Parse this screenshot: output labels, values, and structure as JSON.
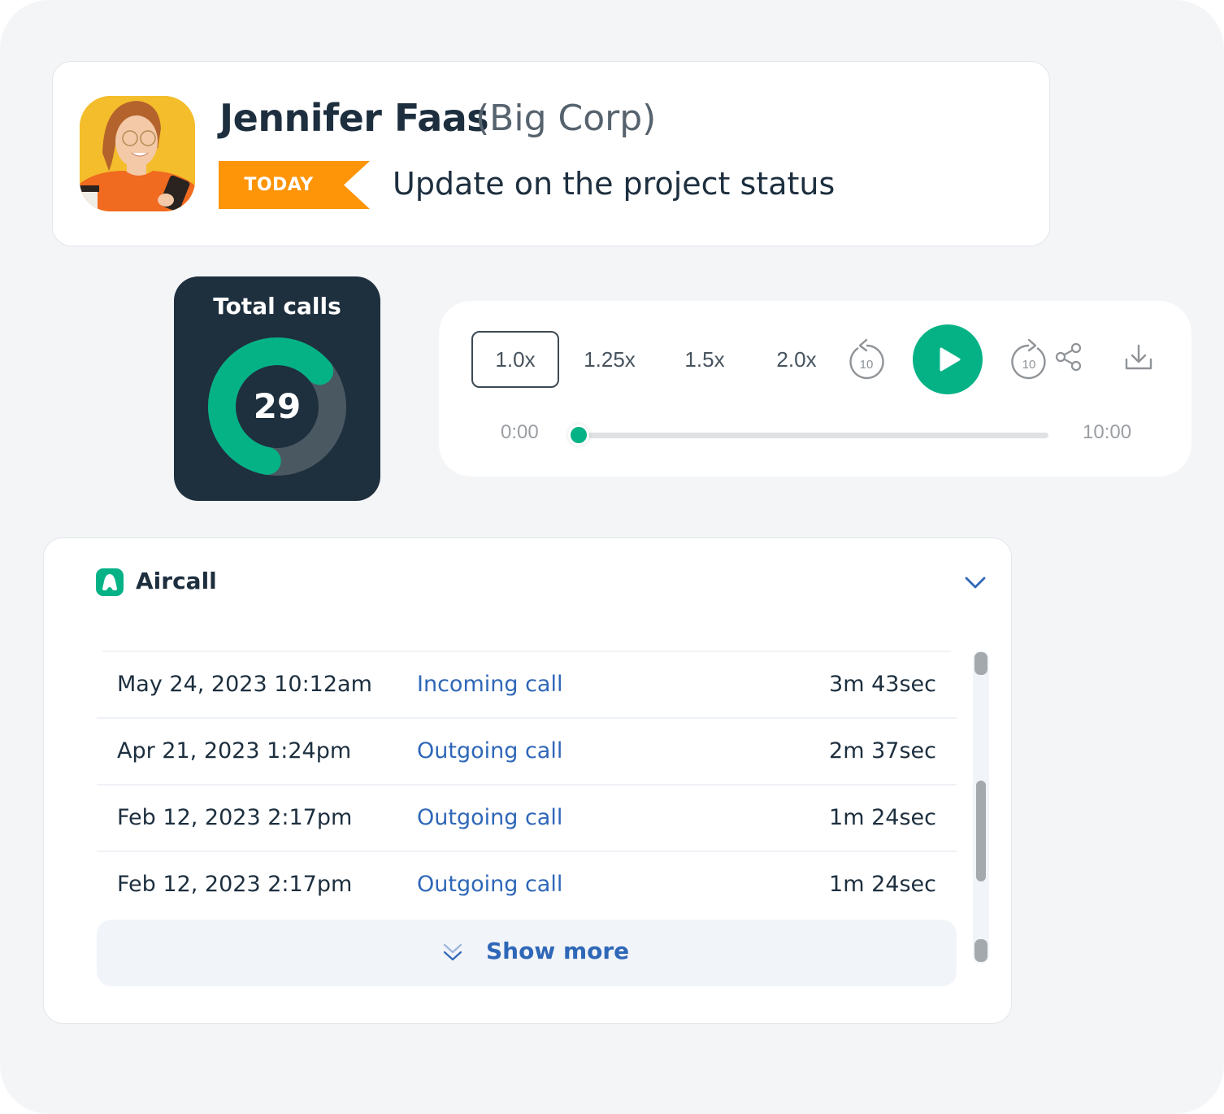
{
  "contact": {
    "name": "Jennifer Faas",
    "company": "(Big Corp)",
    "badge": "TODAY",
    "meeting_title": "Update on the project status",
    "avatar_icon": "person-avatar-photo"
  },
  "total_calls": {
    "title": "Total calls",
    "value": "29",
    "progress_fraction": 0.61,
    "colors": {
      "progress": "#05b286",
      "track": "#4a5862",
      "background": "#1e2f3e"
    }
  },
  "player": {
    "speeds": [
      {
        "label": "1.0x",
        "active": true
      },
      {
        "label": "1.25x",
        "active": false
      },
      {
        "label": "1.5x",
        "active": false
      },
      {
        "label": "2.0x",
        "active": false
      }
    ],
    "rewind_label": "10",
    "forward_label": "10",
    "icons": [
      "rewind-10-icon",
      "play-icon",
      "forward-10-icon",
      "share-icon",
      "download-icon"
    ],
    "current_time": "0:00",
    "total_time": "10:00",
    "progress_fraction": 0.0,
    "accent_color": "#05b286"
  },
  "calls": {
    "provider": "Aircall",
    "provider_color": "#05b286",
    "rows": [
      {
        "date": "May 24, 2023 10:12am",
        "type": "Incoming call",
        "duration": "3m 43sec"
      },
      {
        "date": "Apr 21, 2023 1:24pm",
        "type": "Outgoing call",
        "duration": "2m 37sec"
      },
      {
        "date": "Feb 12, 2023 2:17pm",
        "type": "Outgoing call",
        "duration": "1m 24sec"
      },
      {
        "date": "Feb 12, 2023 2:17pm",
        "type": "Outgoing call",
        "duration": "1m 24sec"
      }
    ],
    "show_more_label": "Show more",
    "link_color": "#2f67b8"
  }
}
